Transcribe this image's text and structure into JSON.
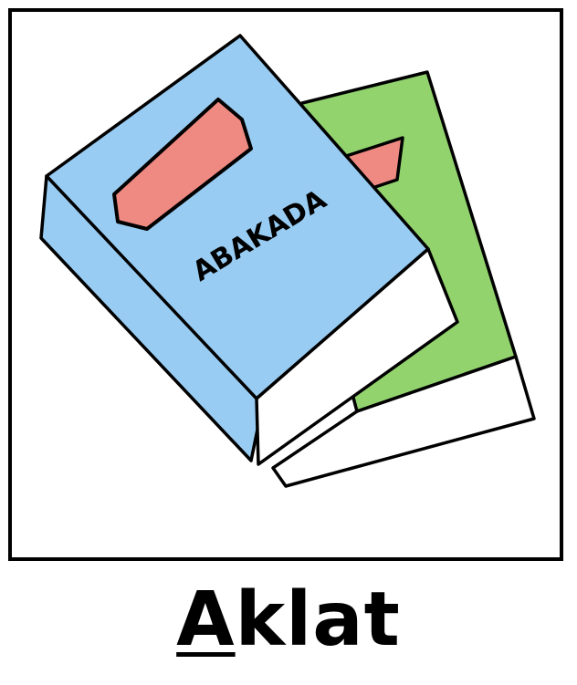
{
  "card": {
    "book_cover_text": "ABAKADA",
    "word_first_letter": "A",
    "word_rest": "klat"
  },
  "colors": {
    "front_book_cover": "#99ccf2",
    "back_book_cover": "#92d36e",
    "bookmark": "#ef8a83",
    "pages": "#ffffff",
    "outline": "#000000"
  },
  "icons": [
    "book-illustration",
    "bookmark-icon"
  ]
}
